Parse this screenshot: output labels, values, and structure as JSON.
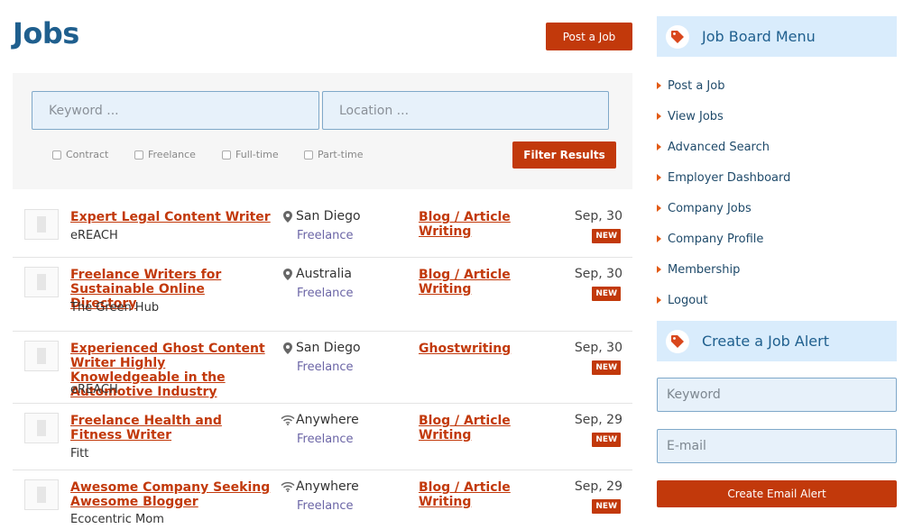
{
  "page": {
    "title": "Jobs",
    "post_job_label": "Post a Job"
  },
  "filters": {
    "keyword_placeholder": "Keyword ...",
    "location_placeholder": "Location ...",
    "types": [
      "Contract",
      "Freelance",
      "Full-time",
      "Part-time"
    ],
    "filter_label": "Filter Results"
  },
  "jobs": [
    {
      "title": "Expert Legal Content Writer",
      "company": "eREACH",
      "location": "San Diego",
      "location_icon": "map-pin-icon",
      "type": "Freelance",
      "category": "Blog / Article Writing",
      "date": "Sep, 30",
      "badge": "NEW"
    },
    {
      "title": "Freelance Writers for Sustainable Online Directory",
      "company": "The Green Hub",
      "location": "Australia",
      "location_icon": "map-pin-icon",
      "type": "Freelance",
      "category": "Blog / Article Writing",
      "date": "Sep, 30",
      "badge": "NEW"
    },
    {
      "title": "Experienced Ghost Content Writer Highly Knowledgeable in the Automotive Industry",
      "company": "eREACH",
      "location": "San Diego",
      "location_icon": "map-pin-icon",
      "type": "Freelance",
      "category": "Ghostwriting",
      "date": "Sep, 30",
      "badge": "NEW"
    },
    {
      "title": "Freelance Health and Fitness Writer",
      "company": "Fitt",
      "location": "Anywhere",
      "location_icon": "wifi-icon",
      "type": "Freelance",
      "category": "Blog / Article Writing",
      "date": "Sep, 29",
      "badge": "NEW"
    },
    {
      "title": "Awesome Company Seeking Awesome Blogger",
      "company": "Ecocentric Mom",
      "location": "Anywhere",
      "location_icon": "wifi-icon",
      "type": "Freelance",
      "category": "Blog / Article Writing",
      "date": "Sep, 29",
      "badge": "NEW"
    }
  ],
  "sidebar": {
    "menu_title": "Job Board Menu",
    "menu_items": [
      "Post a Job",
      "View Jobs",
      "Advanced Search",
      "Employer Dashboard",
      "Company Jobs",
      "Company Profile",
      "Membership",
      "Logout"
    ],
    "alert_title": "Create a Job Alert",
    "alert_keyword_placeholder": "Keyword",
    "alert_email_placeholder": "E-mail",
    "alert_button_label": "Create Email Alert"
  },
  "colors": {
    "brand_blue": "#1f5f8e",
    "accent_orange": "#c2390b",
    "input_bg": "#e7f1fa",
    "panel_bg": "#d9ecfc"
  }
}
